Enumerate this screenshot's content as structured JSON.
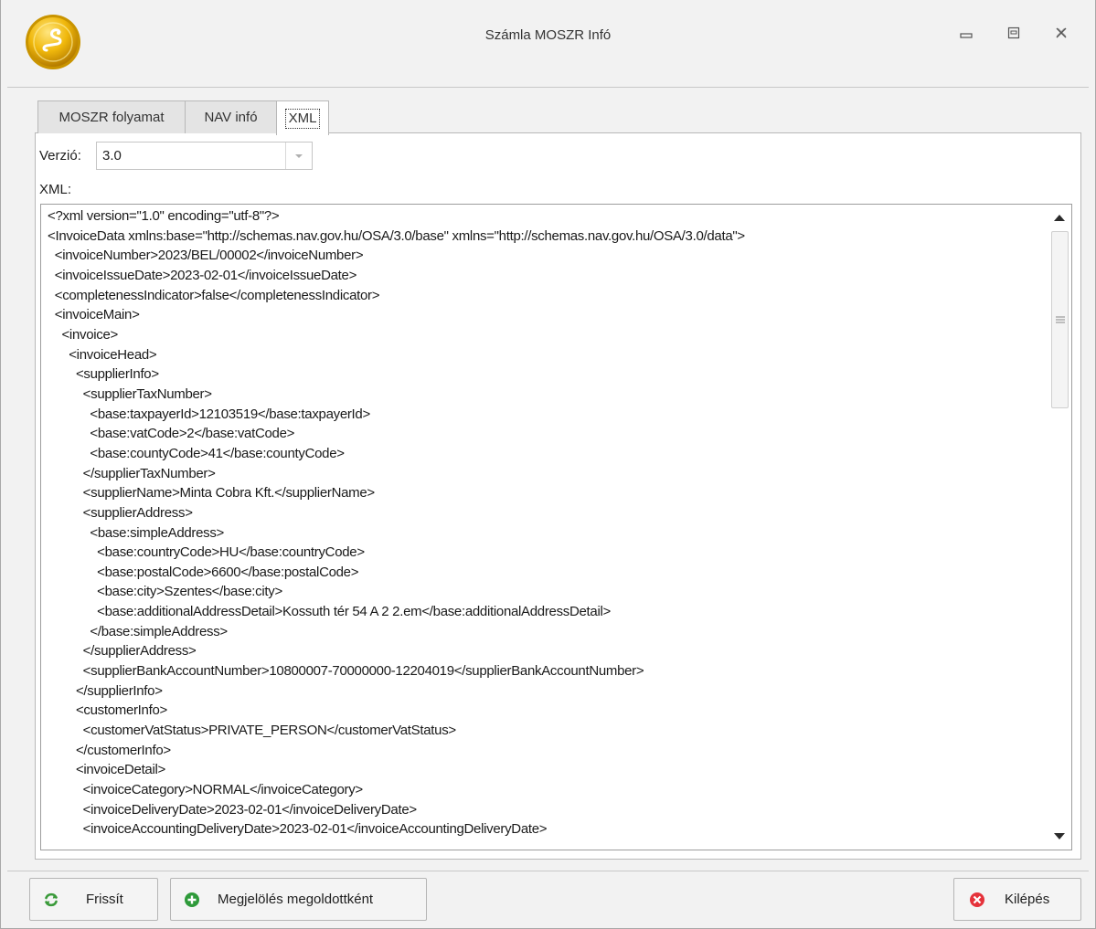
{
  "window": {
    "title": "Számla MOSZR Infó"
  },
  "tabs": [
    {
      "label": "MOSZR folyamat",
      "active": false
    },
    {
      "label": "NAV infó",
      "active": false
    },
    {
      "label": "XML",
      "active": true
    }
  ],
  "version": {
    "label": "Verzió:",
    "value": "3.0"
  },
  "xml": {
    "label": "XML:",
    "lines": [
      "<?xml version=\"1.0\" encoding=\"utf-8\"?>",
      "<InvoiceData xmlns:base=\"http://schemas.nav.gov.hu/OSA/3.0/base\" xmlns=\"http://schemas.nav.gov.hu/OSA/3.0/data\">",
      "  <invoiceNumber>2023/BEL/00002</invoiceNumber>",
      "  <invoiceIssueDate>2023-02-01</invoiceIssueDate>",
      "  <completenessIndicator>false</completenessIndicator>",
      "  <invoiceMain>",
      "    <invoice>",
      "      <invoiceHead>",
      "        <supplierInfo>",
      "          <supplierTaxNumber>",
      "            <base:taxpayerId>12103519</base:taxpayerId>",
      "            <base:vatCode>2</base:vatCode>",
      "            <base:countyCode>41</base:countyCode>",
      "          </supplierTaxNumber>",
      "          <supplierName>Minta Cobra Kft.</supplierName>",
      "          <supplierAddress>",
      "            <base:simpleAddress>",
      "              <base:countryCode>HU</base:countryCode>",
      "              <base:postalCode>6600</base:postalCode>",
      "              <base:city>Szentes</base:city>",
      "              <base:additionalAddressDetail>Kossuth tér 54 A 2 2.em</base:additionalAddressDetail>",
      "            </base:simpleAddress>",
      "          </supplierAddress>",
      "          <supplierBankAccountNumber>10800007-70000000-12204019</supplierBankAccountNumber>",
      "        </supplierInfo>",
      "        <customerInfo>",
      "          <customerVatStatus>PRIVATE_PERSON</customerVatStatus>",
      "        </customerInfo>",
      "        <invoiceDetail>",
      "          <invoiceCategory>NORMAL</invoiceCategory>",
      "          <invoiceDeliveryDate>2023-02-01</invoiceDeliveryDate>",
      "          <invoiceAccountingDeliveryDate>2023-02-01</invoiceAccountingDeliveryDate>"
    ]
  },
  "buttons": {
    "refresh": {
      "label": "Frissít",
      "icon": "refresh-icon",
      "color": "#3a9a3a"
    },
    "mark_resolved": {
      "label": "Megjelölés megoldottként",
      "icon": "plus-circle-icon",
      "color": "#2e9a3a"
    },
    "exit": {
      "label": "Kilépés",
      "icon": "close-circle-icon",
      "color": "#e5323a"
    }
  },
  "colors": {
    "logo": "#e8b10c",
    "window_bg": "#f2f2f2"
  }
}
